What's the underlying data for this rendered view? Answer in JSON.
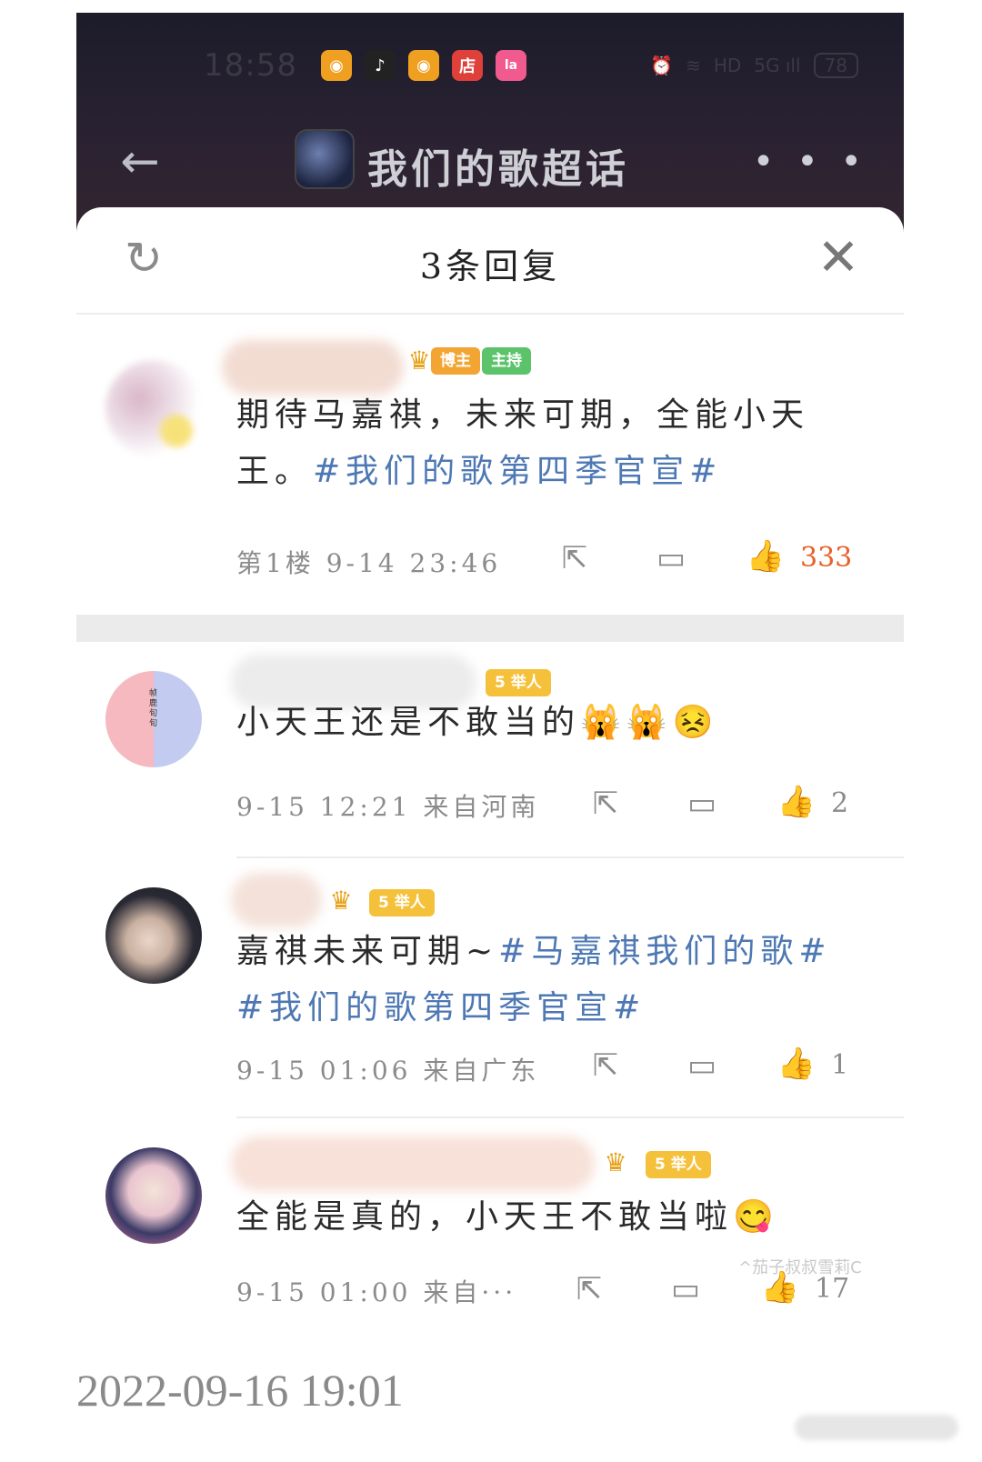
{
  "status_bar": {
    "time": "18:58",
    "apps": [
      {
        "name": "weibo-icon",
        "glyph": "◉",
        "color": "#f0a020"
      },
      {
        "name": "tiktok-icon",
        "glyph": "♪",
        "color": "#222222"
      },
      {
        "name": "weibo-icon",
        "glyph": "◉",
        "color": "#f0a020"
      },
      {
        "name": "shop-icon",
        "glyph": "店",
        "color": "#e0403a"
      },
      {
        "name": "lalai-icon",
        "glyph": "la",
        "color": "#f05a8e"
      }
    ],
    "indicators": {
      "alarm": "⏰",
      "wifi": "≋",
      "hd": "HD",
      "signal": "5G ıll",
      "battery": "78"
    }
  },
  "nav": {
    "back_glyph": "←",
    "title": "我们的歌超话",
    "more_glyph": "• • •"
  },
  "sheet": {
    "title": "3条回复",
    "refresh_glyph": "↻",
    "close_glyph": "✕"
  },
  "comments": [
    {
      "badges": {
        "bozhu": "博主",
        "zhuchi": "主持"
      },
      "text_plain": "期待马嘉祺，未来可期，全能小天王。",
      "text_tag": "#我们的歌第四季官宣#",
      "meta": "第1楼 9-14 23:46",
      "likes": "333",
      "liked": true
    },
    {
      "badges": {
        "level": "5",
        "role": "举人"
      },
      "text_plain": "小天王还是不敢当的",
      "emojis": "🙀🙀😣",
      "meta": "9-15 12:21 来自河南",
      "likes": "2",
      "liked": false,
      "avatar_text": "帧 鹿 旬 旬"
    },
    {
      "badges": {
        "level": "5",
        "role": "举人"
      },
      "text_plain": "嘉祺未来可期~",
      "text_tag": "#马嘉祺我们的歌# #我们的歌第四季官宣#",
      "meta": "9-15 01:06 来自广东",
      "likes": "1",
      "liked": false
    },
    {
      "badges": {
        "level": "5",
        "role": "举人"
      },
      "text_plain": "全能是真的，小天王不敢当啦",
      "emojis": "😋",
      "meta": "9-15 01:00 来自···",
      "likes": "17",
      "liked": false
    }
  ],
  "watermark": "^茄子叔叔雪莉C",
  "footer": {
    "date": "2022-09-16 19:01"
  },
  "colors": {
    "accent_orange": "#e8612a",
    "tag_blue": "#4e78b4",
    "header_dark": "#231e2b"
  }
}
